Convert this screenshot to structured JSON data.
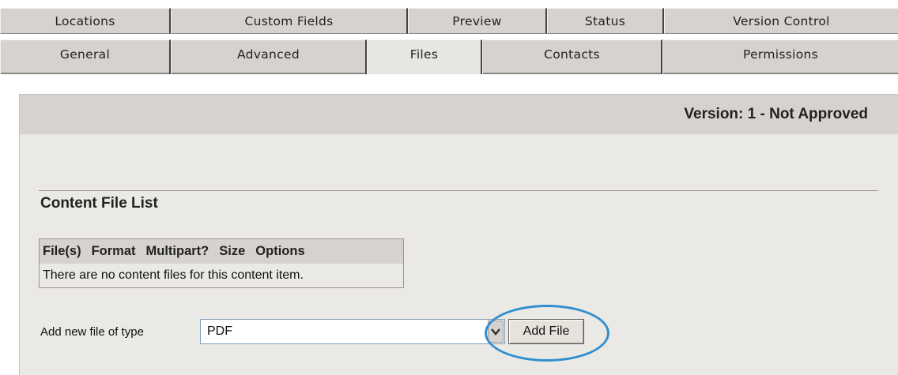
{
  "tabs": {
    "row1": [
      {
        "label": "Locations"
      },
      {
        "label": "Custom Fields"
      },
      {
        "label": "Preview"
      },
      {
        "label": "Status"
      },
      {
        "label": "Version Control"
      }
    ],
    "row2": [
      {
        "label": "General"
      },
      {
        "label": "Advanced"
      },
      {
        "label": "Files",
        "active": true
      },
      {
        "label": "Contacts"
      },
      {
        "label": "Permissions"
      }
    ]
  },
  "version_label": "Version: 1 - Not Approved",
  "content_file_list": {
    "title": "Content File List",
    "columns": [
      "File(s)",
      "Format",
      "Multipart?",
      "Size",
      "Options"
    ],
    "empty_message": "There are no content files for this content item."
  },
  "add_file": {
    "label": "Add new file of type",
    "selected_type": "PDF",
    "button_label": "Add File",
    "highlight_color": "#2f8fcf"
  }
}
